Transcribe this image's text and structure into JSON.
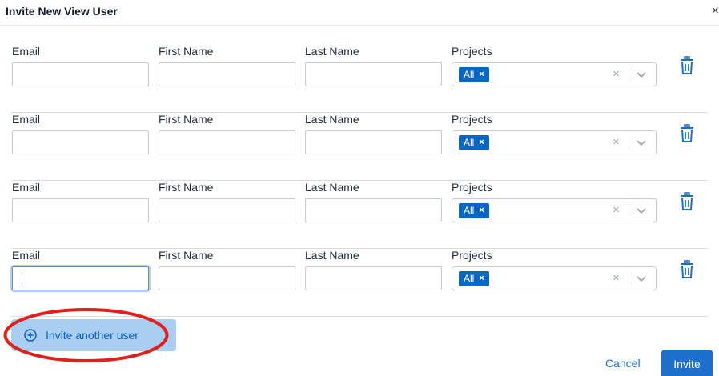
{
  "dialog": {
    "title": "Invite New View User",
    "close_glyph": "×"
  },
  "labels": {
    "email": "Email",
    "first_name": "First Name",
    "last_name": "Last Name",
    "projects": "Projects"
  },
  "rows": [
    {
      "email": "",
      "first_name": "",
      "last_name": "",
      "projects": [
        "All"
      ],
      "focused": false
    },
    {
      "email": "",
      "first_name": "",
      "last_name": "",
      "projects": [
        "All"
      ],
      "focused": false
    },
    {
      "email": "",
      "first_name": "",
      "last_name": "",
      "projects": [
        "All"
      ],
      "focused": false
    },
    {
      "email": "",
      "first_name": "",
      "last_name": "",
      "projects": [
        "All"
      ],
      "focused": true
    }
  ],
  "chip_remove_glyph": "×",
  "clear_glyph": "×",
  "actions": {
    "invite_another": "Invite another user",
    "cancel": "Cancel",
    "invite": "Invite"
  },
  "icons": {
    "trash": "trash-icon",
    "chevron": "chevron-down-icon",
    "plus": "plus-circle-icon"
  },
  "colors": {
    "accent": "#0b66c2",
    "highlight": "#e0201c"
  }
}
